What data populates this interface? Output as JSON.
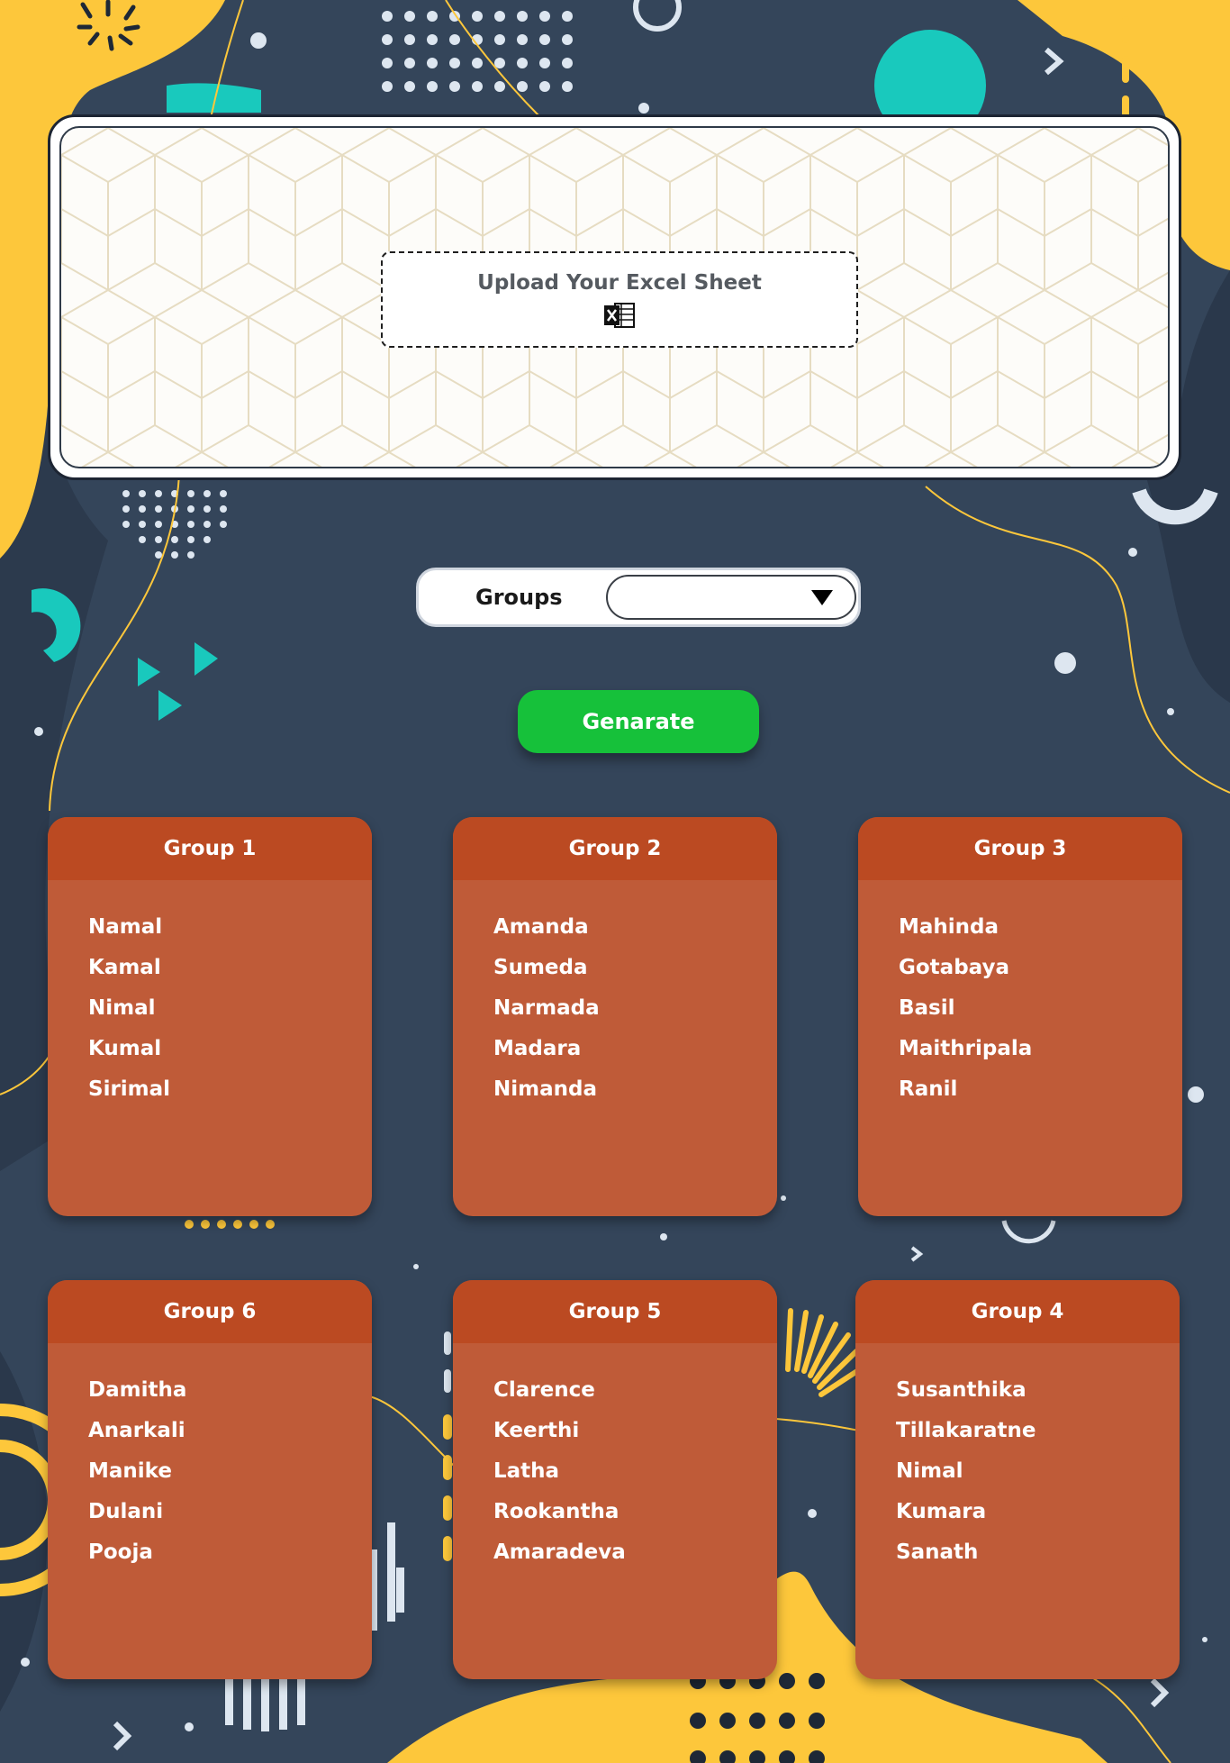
{
  "upload": {
    "label": "Upload Your Excel Sheet",
    "icon": "excel-file-icon"
  },
  "groups_select": {
    "label": "Groups",
    "selected": ""
  },
  "generate": {
    "label": "Genarate"
  },
  "colors": {
    "background": "#34455a",
    "accent_yellow": "#fdc73b",
    "accent_teal": "#19c9bd",
    "card": "#bf5b38",
    "card_header": "#bb4a22",
    "button": "#16c13a"
  },
  "groups": [
    {
      "title": "Group 1",
      "members": [
        "Namal",
        "Kamal",
        "Nimal",
        "Kumal",
        "Sirimal"
      ]
    },
    {
      "title": "Group 2",
      "members": [
        "Amanda",
        "Sumeda",
        "Narmada",
        "Madara",
        "Nimanda"
      ]
    },
    {
      "title": "Group 3",
      "members": [
        "Mahinda",
        "Gotabaya",
        "Basil",
        "Maithripala",
        "Ranil"
      ]
    },
    {
      "title": "Group 6",
      "members": [
        "Damitha",
        "Anarkali",
        "Manike",
        "Dulani",
        "Pooja"
      ]
    },
    {
      "title": "Group 5",
      "members": [
        "Clarence",
        "Keerthi",
        "Latha",
        "Rookantha",
        "Amaradeva"
      ]
    },
    {
      "title": "Group 4",
      "members": [
        "Susanthika",
        "Tillakaratne",
        "Nimal",
        "Kumara",
        "Sanath"
      ]
    }
  ]
}
